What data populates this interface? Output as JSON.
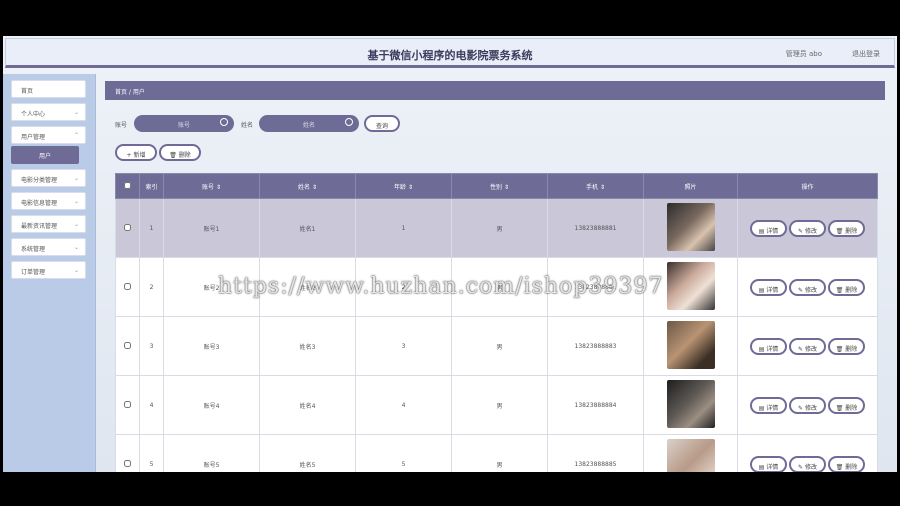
{
  "header": {
    "title": "基于微信小程序的电影院票务系统",
    "user": "管理员 abo",
    "logout": "退出登录"
  },
  "sidebar": {
    "items": [
      {
        "label": "首页",
        "chevron": false
      },
      {
        "label": "个人中心",
        "chevron": true
      },
      {
        "label": "用户管理",
        "chevron": true
      },
      {
        "label": "电影分类管理",
        "chevron": true
      },
      {
        "label": "电影信息管理",
        "chevron": true
      },
      {
        "label": "最新资讯管理",
        "chevron": true
      },
      {
        "label": "系统管理",
        "chevron": true
      },
      {
        "label": "订单管理",
        "chevron": true
      }
    ],
    "sub_item": "用户"
  },
  "breadcrumb": "首页 / 用户",
  "search": {
    "account_label": "账号",
    "account_placeholder": "账号",
    "name_label": "姓名",
    "name_placeholder": "姓名",
    "query_button": "查询"
  },
  "toolbar": {
    "add_button": "+ 新增",
    "delete_button": "🗑 删除"
  },
  "table": {
    "headers": [
      "",
      "索引",
      "账号 ⇕",
      "姓名 ⇕",
      "年龄 ⇕",
      "性别 ⇕",
      "手机 ⇕",
      "照片",
      "操作"
    ],
    "rows": [
      {
        "index": "1",
        "account": "账号1",
        "name": "姓名1",
        "age": "1",
        "gender": "男",
        "phone": "13823888881"
      },
      {
        "index": "2",
        "account": "账号2",
        "name": "姓名2",
        "age": "2",
        "gender": "男",
        "phone": "13823888882"
      },
      {
        "index": "3",
        "account": "账号3",
        "name": "姓名3",
        "age": "3",
        "gender": "男",
        "phone": "13823888883"
      },
      {
        "index": "4",
        "account": "账号4",
        "name": "姓名4",
        "age": "4",
        "gender": "男",
        "phone": "13823888884"
      },
      {
        "index": "5",
        "account": "账号5",
        "name": "姓名5",
        "age": "5",
        "gender": "男",
        "phone": "13823888885"
      }
    ],
    "actions": {
      "detail": "▤ 详情",
      "edit": "✎ 修改",
      "delete": "🗑 删除"
    }
  },
  "watermark": "https://www.huzhan.com/ishop39397"
}
